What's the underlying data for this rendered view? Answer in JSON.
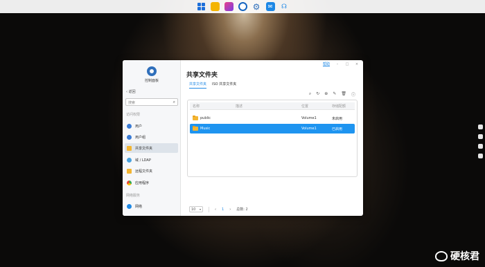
{
  "window": {
    "help_label": "帮助",
    "controls": [
      "–",
      "□",
      "×"
    ]
  },
  "sidebar": {
    "app_title": "控制面板",
    "back_label": "返回",
    "search_placeholder": "搜索",
    "section_access": "访问权限",
    "items": [
      {
        "label": "用户",
        "icon": "user-icon"
      },
      {
        "label": "用户组",
        "icon": "group-icon"
      },
      {
        "label": "共享文件夹",
        "icon": "folder-icon"
      },
      {
        "label": "域 / LDAP",
        "icon": "domain-icon"
      },
      {
        "label": "远程文件夹",
        "icon": "folder-icon"
      },
      {
        "label": "应用程序",
        "icon": "apps-icon"
      }
    ],
    "section_network": "网络服务",
    "network_items": [
      {
        "label": "网络",
        "icon": "network-icon"
      }
    ]
  },
  "main": {
    "title": "共享文件夹",
    "tabs": [
      {
        "label": "共享文件夹",
        "active": true
      },
      {
        "label": "ISO 共享文件夹",
        "active": false
      }
    ],
    "toolbar_icons": [
      "search-icon",
      "refresh-icon",
      "add-icon",
      "edit-icon",
      "delete-icon",
      "info-icon"
    ],
    "table": {
      "headers": [
        "名称",
        "描述",
        "位置",
        "存储配额"
      ],
      "rows": [
        {
          "name": "public",
          "description": "",
          "location": "Volume1",
          "status": "未启用",
          "selected": false
        },
        {
          "name": "Music",
          "description": "",
          "location": "Volume1",
          "status": "已启用",
          "selected": true
        }
      ]
    },
    "pager": {
      "page_size": "10",
      "current_page": "1",
      "total_label": "总数: 2"
    }
  },
  "watermark": {
    "text": "硬核君"
  },
  "colors": {
    "accent": "#1e88e5",
    "selected_row": "#1e94f0",
    "folder": "#f3b532"
  }
}
